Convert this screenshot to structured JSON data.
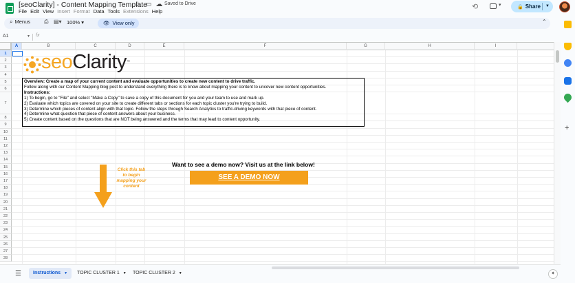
{
  "title_bar": {
    "doc_title": "[seoClarity] - Content Mapping Template",
    "saved_status": "Saved to Drive",
    "menu": [
      {
        "label": "File",
        "enabled": true
      },
      {
        "label": "Edit",
        "enabled": true
      },
      {
        "label": "View",
        "enabled": true
      },
      {
        "label": "Insert",
        "enabled": false
      },
      {
        "label": "Format",
        "enabled": false
      },
      {
        "label": "Data",
        "enabled": true
      },
      {
        "label": "Tools",
        "enabled": true
      },
      {
        "label": "Extensions",
        "enabled": false
      },
      {
        "label": "Help",
        "enabled": true
      }
    ],
    "share_label": "Share"
  },
  "toolbar": {
    "menus_label": "Menus",
    "zoom": "100%",
    "view_only_label": "View only"
  },
  "formula_bar": {
    "cell_ref": "A1",
    "fx": "fx"
  },
  "grid": {
    "columns": [
      "A",
      "B",
      "C",
      "D",
      "E",
      "F",
      "G",
      "H",
      "I",
      "J"
    ],
    "rows": [
      "1",
      "2",
      "3",
      "4",
      "5",
      "6",
      "7",
      "8",
      "9",
      "10",
      "11",
      "12",
      "13",
      "14",
      "15",
      "16",
      "17",
      "18",
      "19",
      "20",
      "21",
      "22",
      "23",
      "24",
      "25",
      "26",
      "27",
      "28"
    ]
  },
  "logo": {
    "seo": "seo",
    "clarity": "Clarity",
    "tm": "™"
  },
  "overview": {
    "heading": "Overview: Create a map of your current content and evaluate opportunities to create new content to drive traffic.",
    "follow": "Follow along with our Content Mapping blog post to understand everything there is to know about mapping your content to uncover new content opportunities.",
    "instructions_label": "Instructions:",
    "steps": [
      "1) To begin, go to \"File\" and select \"Make a Copy\" to save a copy of this document for you and your team to use and mark up.",
      "2) Evaluate which topics are covered on your site to create different tabs or sections for each topic cluster you're trying to build.",
      "3) Determine which pieces of content align with that topic. Follow the steps through Search Analytics to traffic-driving keywords with that piece of content.",
      "4) Determine what question that piece of content answers about your business.",
      "5) Create content based on the questions that are NOT being answered and the terms that may lead to content opportunity."
    ]
  },
  "demo": {
    "prompt": "Want to see a demo now? Visit us at the link below!",
    "button_label": "SEE A DEMO NOW",
    "click_note": "Click this tab to begin mapping your content"
  },
  "sheet_tabs": [
    {
      "label": "Instructions",
      "active": true
    },
    {
      "label": "TOPIC CLUSTER 1",
      "active": false
    },
    {
      "label": "TOPIC CLUSTER 2",
      "active": false
    }
  ],
  "colors": {
    "accent_orange": "#f4a01c",
    "share_bg": "#c2e7ff",
    "sheets_green": "#0f9d58"
  }
}
